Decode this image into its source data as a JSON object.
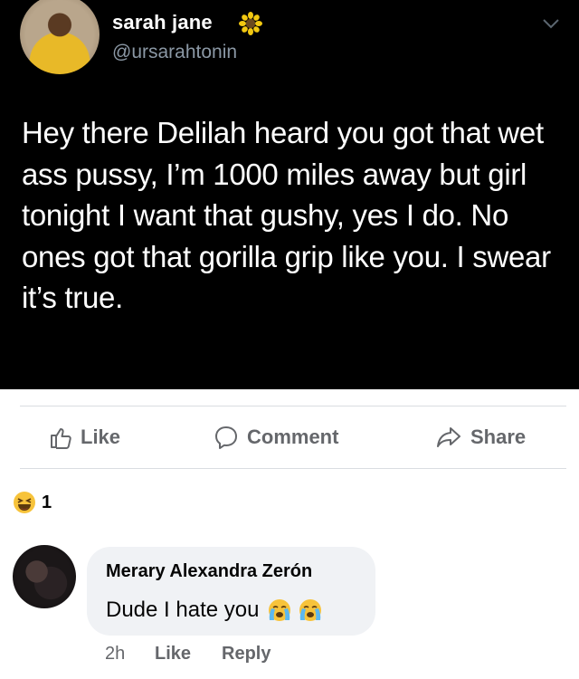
{
  "tweet": {
    "author_name": "sarah jane",
    "author_handle": "@ursarahtonin",
    "name_emoji": "sunflower-icon",
    "text": "Hey there Delilah heard you got that wet ass pussy, I’m 1000 miles away but girl tonight I want that gushy, yes I do. No ones got that gorilla grip like you. I swear it’s true."
  },
  "post_actions": {
    "like_label": "Like",
    "comment_label": "Comment",
    "share_label": "Share"
  },
  "reactions": {
    "icon": "laughing-emoji-icon",
    "count": "1"
  },
  "comment": {
    "author": "Merary Alexandra Zerón",
    "text": "Dude I hate you",
    "emojis": [
      "loudly-crying-emoji-icon",
      "loudly-crying-emoji-icon"
    ],
    "time": "2h",
    "like_label": "Like",
    "reply_label": "Reply"
  },
  "colors": {
    "tweet_bg": "#000000",
    "handle_gray": "#8b98a5",
    "fb_action_gray": "#65676b",
    "bubble_bg": "#f0f2f5"
  }
}
